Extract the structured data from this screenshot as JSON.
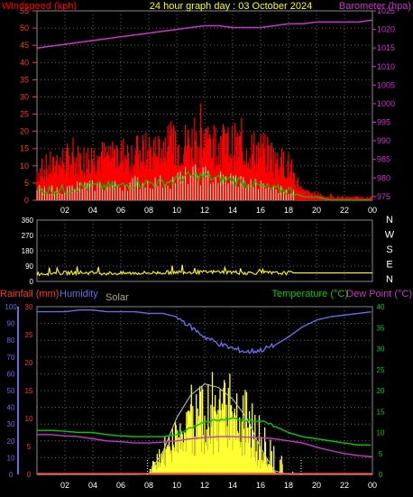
{
  "title": "24 hour graph day : 03 October 2024",
  "colors": {
    "wind": "#ff0000",
    "gust_fill": "#ff0000",
    "wind_avg": "#00cc00",
    "wind_light": "#c8f0c8",
    "baro": "#cc33cc",
    "dir": "#ffff00",
    "temp": "#00cc00",
    "dew": "#cc33cc",
    "hum": "#6a6ae8",
    "rain": "#ff3333",
    "solar": "#ffff33",
    "solar_theory": "#c8c8c8",
    "grid": "#666666",
    "axis": "#ffffff",
    "title": "#ffff00"
  },
  "chart_data": [
    {
      "type": "line",
      "name_left": "Windspeed (kph)",
      "name_right": "Barometer (hpa)",
      "x_ticks": [
        "02",
        "04",
        "06",
        "08",
        "10",
        "12",
        "14",
        "16",
        "18",
        "20",
        "22",
        "00"
      ],
      "ylim_left": [
        0,
        55
      ],
      "yticks_left": [
        0,
        5,
        10,
        15,
        20,
        25,
        30,
        35,
        40,
        45,
        50,
        55
      ],
      "ylim_right": [
        974,
        1025
      ],
      "yticks_right": [
        975,
        980,
        985,
        990,
        995,
        1000,
        1005,
        1010,
        1015,
        1020,
        1025
      ],
      "hours": [
        0,
        1,
        2,
        3,
        4,
        5,
        6,
        7,
        8,
        9,
        10,
        11,
        12,
        13,
        14,
        15,
        16,
        17,
        18,
        19,
        20,
        21,
        22,
        23,
        24
      ],
      "gust": [
        10,
        12,
        14,
        14,
        15,
        15,
        16,
        16,
        17,
        18,
        19,
        20,
        20,
        19,
        19,
        18,
        17,
        14,
        12,
        3,
        2,
        1,
        1,
        1,
        1
      ],
      "gust_peak": [
        14,
        16,
        18,
        20,
        20,
        19,
        22,
        21,
        22,
        24,
        25,
        30,
        27,
        26,
        24,
        22,
        20,
        18,
        16,
        4,
        3,
        2,
        1,
        1,
        1
      ],
      "speed_avg": [
        3,
        3,
        3,
        4,
        4,
        4,
        4,
        5,
        5,
        5,
        6,
        7,
        7,
        6,
        6,
        5,
        4,
        3,
        3,
        1,
        1,
        0,
        0,
        0,
        0
      ],
      "barometer": [
        1015,
        1015.5,
        1016,
        1016.5,
        1017,
        1017.5,
        1018,
        1018.5,
        1019,
        1019.5,
        1020,
        1020.5,
        1021,
        1021,
        1020.5,
        1020.5,
        1020.5,
        1021,
        1021.5,
        1021.5,
        1022,
        1022,
        1022,
        1022,
        1022.5
      ]
    },
    {
      "type": "line",
      "name": "Wind direction",
      "x_ticks": [
        "02",
        "04",
        "06",
        "08",
        "10",
        "12",
        "14",
        "16",
        "18",
        "20",
        "22",
        "00"
      ],
      "ylim": [
        0,
        360
      ],
      "yticks": [
        0,
        90,
        180,
        270,
        360
      ],
      "right_labels": [
        "N",
        "W",
        "S",
        "E",
        "N"
      ],
      "hours": [
        0,
        1,
        2,
        3,
        4,
        5,
        6,
        7,
        8,
        9,
        10,
        11,
        12,
        13,
        14,
        15,
        16,
        17,
        18,
        19,
        20,
        21,
        22,
        23,
        24
      ],
      "direction": [
        45,
        48,
        50,
        52,
        50,
        48,
        47,
        49,
        50,
        52,
        55,
        55,
        53,
        56,
        54,
        50,
        52,
        48,
        50,
        50,
        50,
        50,
        50,
        50,
        50
      ]
    },
    {
      "type": "line",
      "name_rain": "Rainfall (mm)",
      "name_hum": "Humidity",
      "name_solar": "Solar",
      "name_temp": "Temperature (°C)",
      "name_dew": "Dew Point (°C)",
      "x_ticks": [
        "02",
        "04",
        "06",
        "08",
        "10",
        "12",
        "14",
        "16",
        "18",
        "20",
        "22",
        "00"
      ],
      "yticks_hum": [
        0,
        10,
        20,
        30,
        40,
        50,
        60,
        70,
        80,
        90,
        100
      ],
      "yticks_rain": [
        0,
        5,
        10,
        15,
        20,
        25,
        30
      ],
      "yticks_temp": [
        0,
        5,
        10,
        15,
        20,
        25,
        30,
        35,
        40
      ],
      "hours": [
        0,
        1,
        2,
        3,
        4,
        5,
        6,
        7,
        8,
        9,
        10,
        11,
        12,
        13,
        14,
        15,
        16,
        17,
        18,
        19,
        20,
        21,
        22,
        23,
        24
      ],
      "humidity": [
        97,
        97,
        97,
        98,
        98,
        97,
        97,
        97,
        96,
        96,
        94,
        88,
        82,
        78,
        75,
        73,
        74,
        77,
        82,
        88,
        92,
        94,
        95,
        96,
        97
      ],
      "temperature": [
        10.5,
        10.5,
        10.3,
        10,
        10,
        9.5,
        9.2,
        9,
        9,
        9,
        9.5,
        11,
        12.5,
        13,
        13.3,
        13,
        12.7,
        11.5,
        10,
        9,
        8.5,
        8,
        7.5,
        7,
        7
      ],
      "dewpoint": [
        9.5,
        9.5,
        9.2,
        9,
        8.5,
        8,
        7.8,
        7.5,
        7.5,
        7.7,
        8,
        8.5,
        8.8,
        9,
        9,
        8.9,
        8.8,
        8.5,
        8,
        7.5,
        6.5,
        5.7,
        5,
        4.5,
        4.2
      ],
      "rain": [
        0,
        0,
        0,
        0,
        0,
        0,
        0,
        0,
        0,
        0,
        0,
        0,
        0,
        0,
        0,
        0,
        0,
        0,
        0,
        0,
        0,
        0,
        0,
        0,
        0
      ],
      "solar_theory": [
        0,
        0,
        0,
        0,
        0,
        0,
        0,
        0,
        0.2,
        6,
        15,
        21,
        24,
        23,
        20,
        15,
        7,
        1,
        0,
        0,
        0,
        0,
        0,
        0,
        0
      ],
      "solar_peak": [
        0,
        0,
        0,
        0,
        0,
        0,
        0,
        0,
        1,
        9,
        13,
        22,
        24,
        25,
        24,
        20,
        14,
        8,
        1,
        0,
        0,
        0,
        0,
        0,
        0
      ]
    }
  ]
}
